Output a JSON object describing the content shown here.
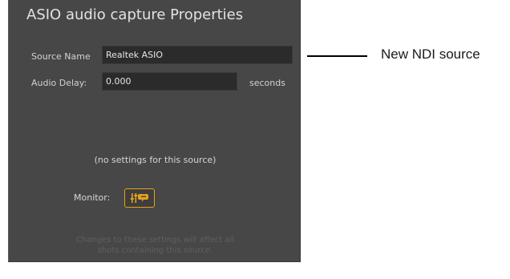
{
  "dialog": {
    "title": "ASIO audio capture Properties",
    "source_name_label": "Source Name",
    "source_name_value": "Realtek ASIO",
    "audio_delay_label": "Audio Delay:",
    "audio_delay_value": "0.000",
    "audio_delay_unit": "seconds",
    "no_settings_text": "(no settings for this source)",
    "monitor_label": "Monitor:",
    "monitor_icon": "audio-monitor-icon",
    "hint_line_1": "Changes to these settings will affect all",
    "hint_line_2": "shots containing this source."
  },
  "callout": {
    "text": "New NDI source"
  },
  "colors": {
    "panel_bg": "#474747",
    "input_bg": "#2b2b2b",
    "accent": "#e6a11a"
  }
}
